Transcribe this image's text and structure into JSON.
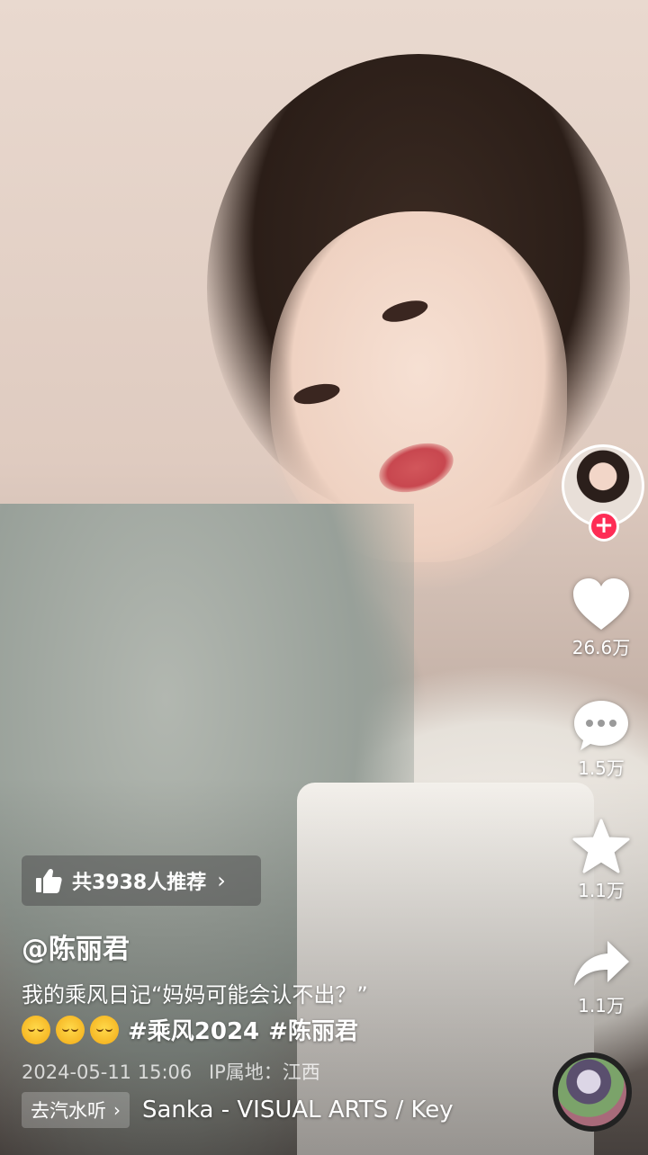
{
  "video": {
    "author": "@陈丽君",
    "description": "我的乘风日记“妈妈可能会认不出？”",
    "emojis": [
      "relieved-face",
      "relieved-face",
      "relieved-face"
    ],
    "tags": [
      "#乘风2024",
      "#陈丽君"
    ],
    "date": "2024-05-11 15:06",
    "ip_location": "IP属地：江西"
  },
  "recommend": {
    "label": "共3938人推荐",
    "chevron": "›",
    "icon": "thumbs-up-icon"
  },
  "actions": {
    "like_count": "26.6万",
    "comment_count": "1.5万",
    "favorite_count": "1.1万",
    "share_count": "1.1万",
    "follow_symbol": "+"
  },
  "music": {
    "listen_label": "去汽水听",
    "listen_chevron": "›",
    "title": "Sanka - VISUAL ARTS / Key"
  },
  "colors": {
    "follow_accent": "#fe2c55",
    "text": "#ffffff"
  }
}
